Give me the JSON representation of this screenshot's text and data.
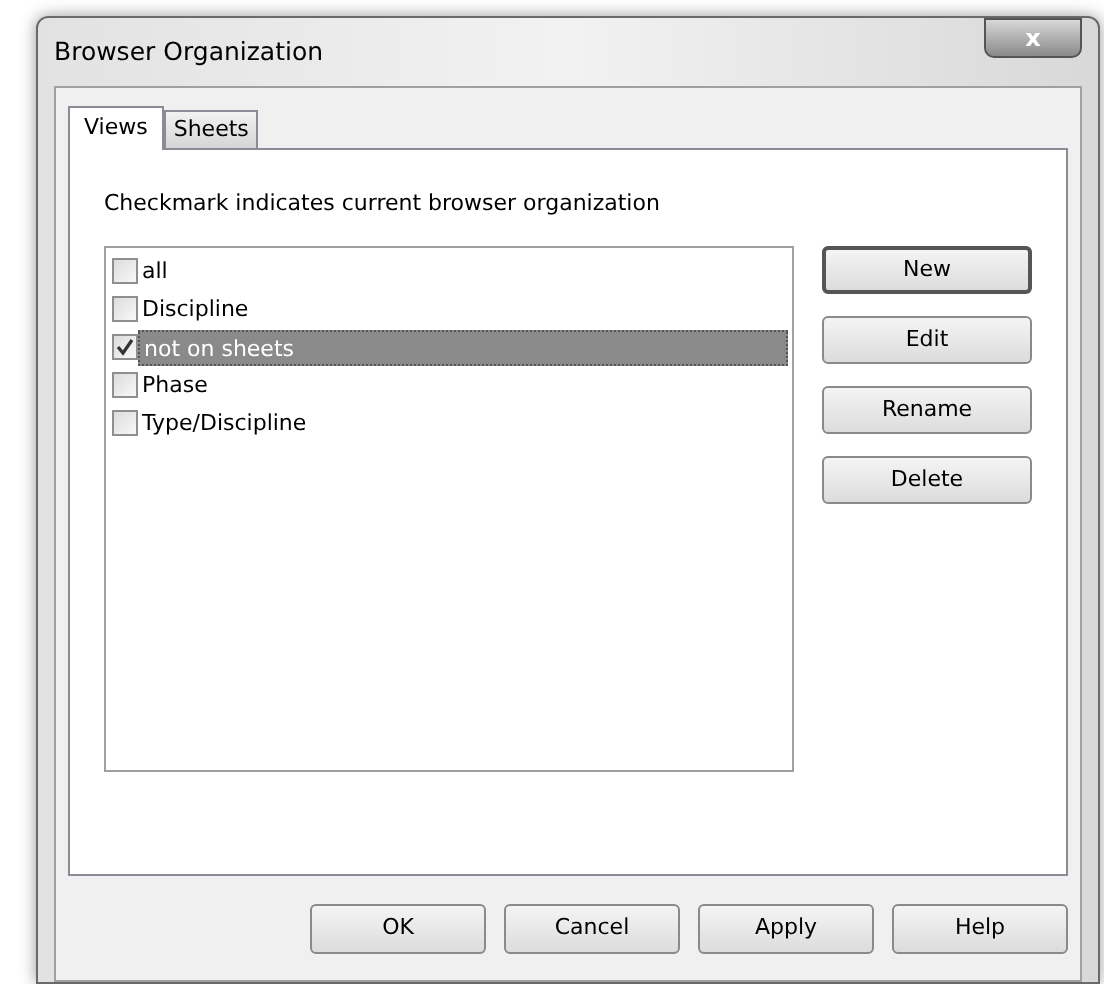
{
  "window": {
    "title": "Browser Organization",
    "close": "x"
  },
  "tabs": [
    {
      "label": "Views",
      "selected": true
    },
    {
      "label": "Sheets",
      "selected": false
    }
  ],
  "instruction": "Checkmark indicates current browser organization",
  "items": [
    {
      "label": "all",
      "checked": false,
      "selected": false
    },
    {
      "label": "Discipline",
      "checked": false,
      "selected": false
    },
    {
      "label": "not on sheets",
      "checked": true,
      "selected": true
    },
    {
      "label": "Phase",
      "checked": false,
      "selected": false
    },
    {
      "label": "Type/Discipline",
      "checked": false,
      "selected": false
    }
  ],
  "side_buttons": [
    {
      "label": "New",
      "default": true
    },
    {
      "label": "Edit",
      "default": false
    },
    {
      "label": "Rename",
      "default": false
    },
    {
      "label": "Delete",
      "default": false
    }
  ],
  "footer_buttons": [
    "OK",
    "Cancel",
    "Apply",
    "Help"
  ]
}
